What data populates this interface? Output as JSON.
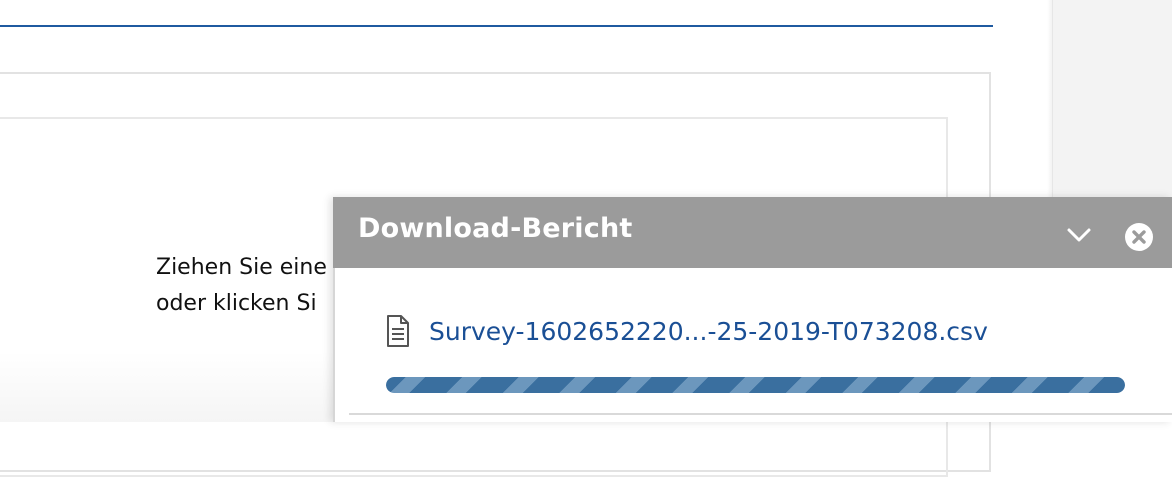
{
  "background": {
    "dropzone_lines": [
      "Ziehen Sie eine",
      "oder klicken Si"
    ]
  },
  "download_panel": {
    "title": "Download-Bericht",
    "collapse_icon": "chevron-down-icon",
    "close_icon": "close-circle-icon",
    "file": {
      "icon": "document-icon",
      "name": "Survey-1602652220...-25-2019-T073208.csv"
    },
    "progress": 1.0
  },
  "colors": {
    "accent": "#1f5aa0",
    "link": "#1a4f95",
    "panel_header": "#9b9b9b",
    "progress_dark": "#3a6f9f",
    "progress_light": "#6c97bd"
  }
}
